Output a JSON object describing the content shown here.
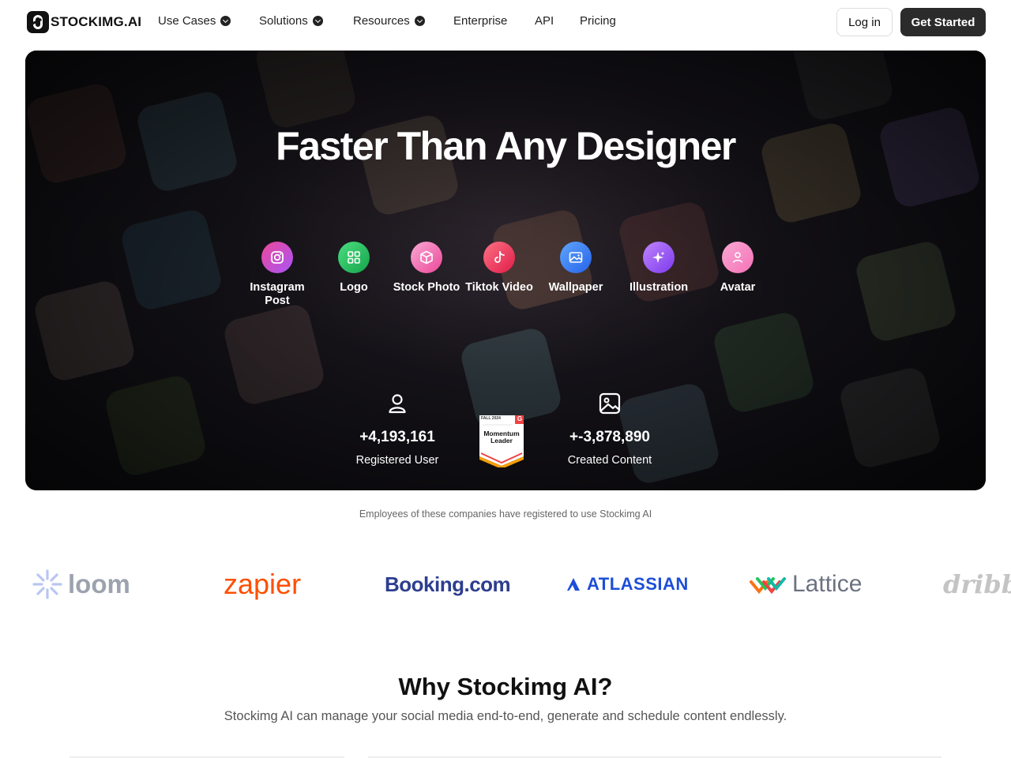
{
  "nav": {
    "logo_text": "STOCKIMG.AI",
    "items": [
      {
        "label": "Use Cases",
        "dropdown": true
      },
      {
        "label": "Solutions",
        "dropdown": true
      },
      {
        "label": "Resources",
        "dropdown": true
      },
      {
        "label": "Enterprise",
        "dropdown": false
      },
      {
        "label": "API",
        "dropdown": false
      },
      {
        "label": "Pricing",
        "dropdown": false
      }
    ],
    "login_label": "Log in",
    "get_started_label": "Get Started"
  },
  "hero": {
    "title": "Faster Than Any Designer",
    "categories": [
      {
        "label": "Instagram Post",
        "icon": "instagram-icon",
        "color": "#d946ef"
      },
      {
        "label": "Logo",
        "icon": "grid-icon",
        "color": "#22c55e"
      },
      {
        "label": "Stock Photo",
        "icon": "box-icon",
        "color": "#f472b6"
      },
      {
        "label": "Tiktok Video",
        "icon": "tiktok-icon",
        "color": "#f43f5e"
      },
      {
        "label": "Wallpaper",
        "icon": "image-icon",
        "color": "#3b82f6"
      },
      {
        "label": "Illustration",
        "icon": "sparkle-icon",
        "color": "#a855f7"
      },
      {
        "label": "Avatar",
        "icon": "user-icon",
        "color": "#f472b6"
      }
    ],
    "stats": {
      "users_number": "+4,193,161",
      "users_label": "Registered User",
      "content_number": "+-3,878,890",
      "content_label": "Created Content"
    },
    "badge": {
      "season": "FALL 2024",
      "line1": "Momentum",
      "line2": "Leader",
      "mark": "G"
    }
  },
  "companies": {
    "note": "Employees of these companies have registered to use Stockimg AI",
    "brands": [
      {
        "name": "loom",
        "color": "#9ca3af"
      },
      {
        "name": "zapier",
        "color": "#ff4f00"
      },
      {
        "name": "Booking.com",
        "color": "#2d3e8f"
      },
      {
        "name": "ATLASSIAN",
        "color": "#1d4ed8"
      },
      {
        "name": "Lattice",
        "color": "#6b7280"
      },
      {
        "name": "dribbble",
        "color": "#c4c4c4"
      }
    ]
  },
  "why": {
    "title": "Why Stockimg AI?",
    "subtitle": "Stockimg AI can manage your social media end-to-end, generate and schedule content endlessly."
  }
}
